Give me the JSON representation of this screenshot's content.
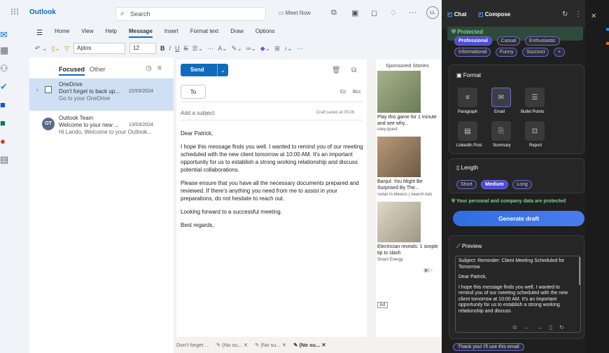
{
  "app": {
    "name": "Outlook",
    "search_placeholder": "Search",
    "meet_now": "Meet Now",
    "avatar": "LL"
  },
  "ribbon": {
    "tabs": [
      {
        "label": "Home"
      },
      {
        "label": "View"
      },
      {
        "label": "Help"
      },
      {
        "label": "Message",
        "active": true
      },
      {
        "label": "Insert"
      },
      {
        "label": "Format text"
      },
      {
        "label": "Draw"
      },
      {
        "label": "Options"
      }
    ],
    "font": "Aptos",
    "size": "12"
  },
  "mail_tabs": {
    "focused": "Focused",
    "other": "Other"
  },
  "mails": [
    {
      "from": "OneDrive",
      "subject": "Don't forget to back up...",
      "date": "22/03/2024",
      "preview": "Go to your OneDrive",
      "selected": true
    },
    {
      "from": "Outlook Team",
      "subject": "Welcome to your new ...",
      "date": "13/03/2024",
      "preview": "Hi Lando, Welcome to your Outlook...",
      "avatar": "OT"
    }
  ],
  "compose": {
    "send": "Send",
    "to_label": "To",
    "cc": "Cc",
    "bcc": "Bcc",
    "subject_placeholder": "Add a subject",
    "draft_saved": "Draft saved at 09:26",
    "body": [
      "Dear Patrick,",
      "I hope this message finds you well. I wanted to remind you of our meeting scheduled with the new client tomorrow at 10:00 AM. It's an important opportunity for us to establish a strong working relationship and discuss potential collaborations.",
      "Please ensure that you have all the necessary documents prepared and reviewed. If there's anything you need from me to assist in your preparations, do not hesitate to reach out.",
      "Looking forward to a successful meeting.",
      "Best regards,"
    ]
  },
  "ads": {
    "title": "Sponsored Stories",
    "items": [
      {
        "caption": "Play this game for 1 minute and see why...",
        "source": "navy.quest"
      },
      {
        "caption": "Banjul: You Might Be Surprised By The...",
        "source": "Sofas In Mexico | Search Ads"
      },
      {
        "caption": "Electrician reveals: 1 simple tip to slash",
        "source": "Smart Energy"
      }
    ],
    "ad_label": "Ad"
  },
  "bottom_tabs": [
    "Don't forget ...",
    "(No su...",
    "(No su...",
    "(No su..."
  ],
  "copilot": {
    "tabs": {
      "chat": "Chat",
      "compose": "Compose"
    },
    "protected": "Protected",
    "tones_top": [
      "Professional",
      "Casual",
      "Enthusiastic"
    ],
    "tones": [
      {
        "label": "Informational"
      },
      {
        "label": "Funny"
      },
      {
        "label": "Succinct"
      },
      {
        "label": "+"
      }
    ],
    "format_title": "Format",
    "formats": [
      {
        "label": "Paragraph"
      },
      {
        "label": "Email",
        "selected": true
      },
      {
        "label": "Bullet Points"
      },
      {
        "label": "LinkedIn Post"
      },
      {
        "label": "Summary"
      },
      {
        "label": "Report"
      }
    ],
    "length_title": "Length",
    "lengths": [
      {
        "label": "Short"
      },
      {
        "label": "Medium",
        "selected": true
      },
      {
        "label": "Long"
      }
    ],
    "data_protected": "Your personal and company data are protected",
    "generate": "Generate draft",
    "preview_title": "Preview",
    "preview_text": [
      "Subject: Reminder: Client Meeting Scheduled for Tomorrow",
      "Dear Patrick,",
      "I hope this message finds you well. I wanted to remind you of our meeting scheduled with the new client tomorrow at 10:00 AM. It's an important opportunity for us to establish a strong working relationship and discuss"
    ],
    "use_button": "Thank you! I'll use this email"
  }
}
